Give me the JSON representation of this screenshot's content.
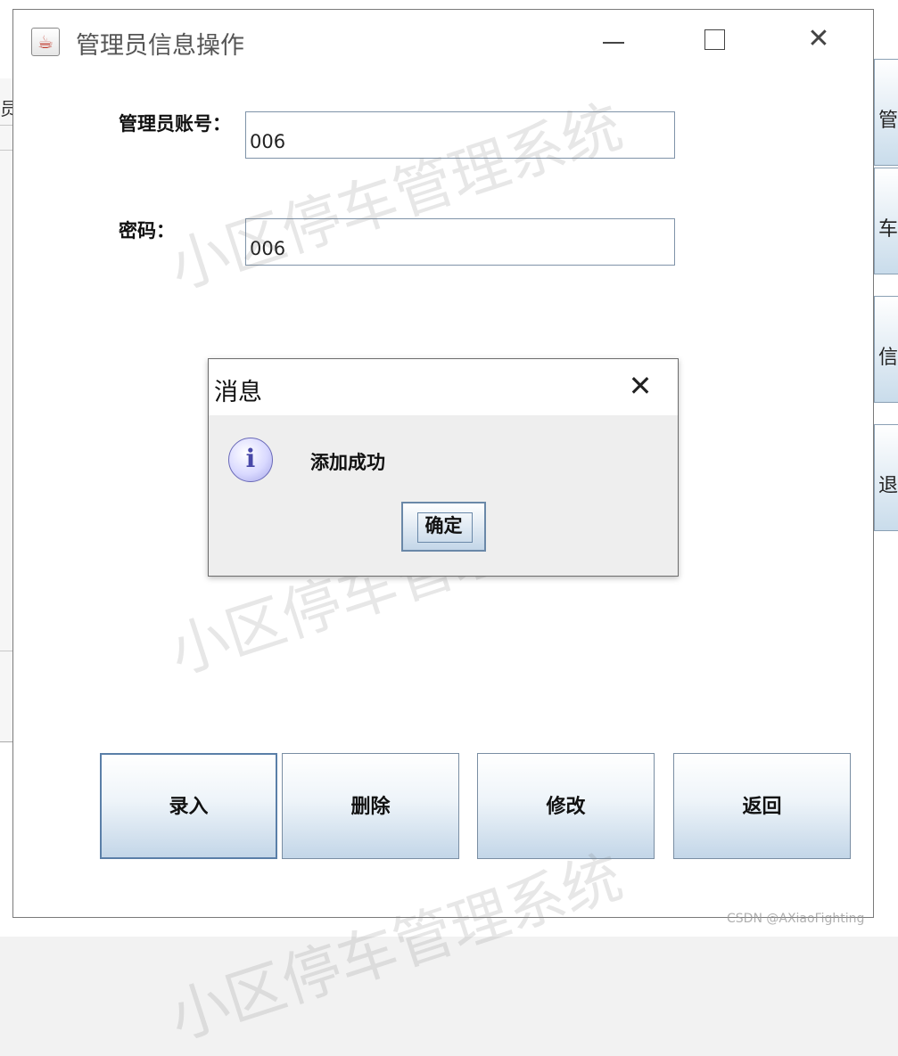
{
  "window": {
    "title": "管理员信息操作",
    "icon": "java-cup-icon"
  },
  "form": {
    "account_label": "管理员账号：",
    "account_value": "006",
    "password_label": "密码：",
    "password_value": "006"
  },
  "buttons": {
    "add": "录入",
    "delete": "删除",
    "modify": "修改",
    "back": "返回"
  },
  "dialog": {
    "title": "消息",
    "message": "添加成功",
    "ok": "确定",
    "icon": "info-icon"
  },
  "background": {
    "left_fragment": "员",
    "right_fragments": [
      "管",
      "车",
      "信",
      "退"
    ]
  },
  "watermark": {
    "text": "小区停车管理系统"
  },
  "credit": "CSDN @AXiaoFighting",
  "colors": {
    "button_gradient_bottom": "#c3d6e8",
    "border": "#7f93a8"
  }
}
